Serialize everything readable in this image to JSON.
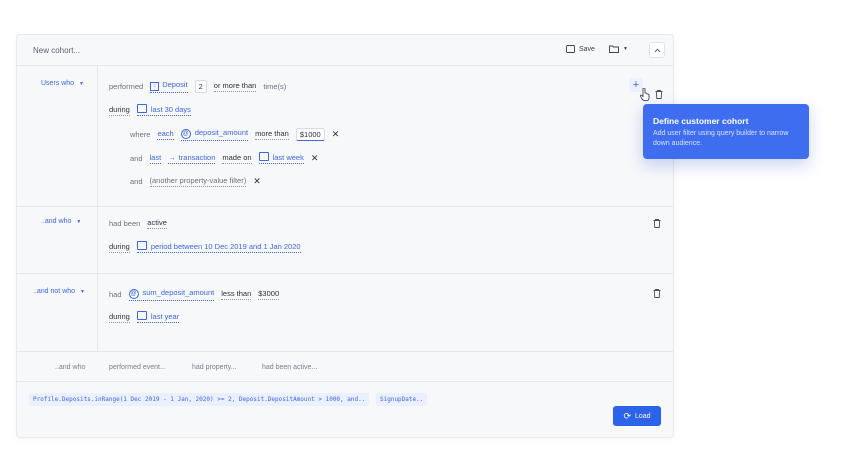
{
  "header": {
    "title": "New cohort...",
    "save_label": "Save"
  },
  "groups": [
    {
      "label": "Users who",
      "row1": {
        "performed": "performed",
        "event": "Deposit",
        "count": "2",
        "operator": "or more than",
        "unit": "time(s)"
      },
      "during": {
        "label": "during",
        "value": "last 30 days"
      },
      "where": {
        "label": "where",
        "quantifier": "each",
        "property": "deposit_amount",
        "operator": "more than",
        "value": "$1000"
      },
      "and1": {
        "label": "and",
        "quantifier": "last",
        "event": "transaction",
        "operator": "made on",
        "value": "last week"
      },
      "and2": {
        "label": "and",
        "placeholder": "(another property-value filter)"
      }
    },
    {
      "label": "..and who",
      "had_been": "had been",
      "state": "active",
      "during": {
        "label": "during",
        "value": "period between 10 Dec 2019 and 1 Jan 2020"
      }
    },
    {
      "label": "..and not who",
      "had": "had",
      "property": "sum_deposit_amount",
      "operator": "less than",
      "value": "$3000",
      "during": {
        "label": "during",
        "value": "last year"
      }
    }
  ],
  "add_options": [
    "..and who",
    "performed event...",
    "had property...",
    "had been active..."
  ],
  "query_chips": [
    "Profile.Deposits.inRange(1 Dec 2019 - 1 Jan, 2020) >= 2, Deposit.DepositAmount > 1000, and..",
    "SignupDate.."
  ],
  "load_label": "Load",
  "tooltip": {
    "title": "Define customer cohort",
    "body": "Add user filter using query builder to narrow down audience."
  }
}
